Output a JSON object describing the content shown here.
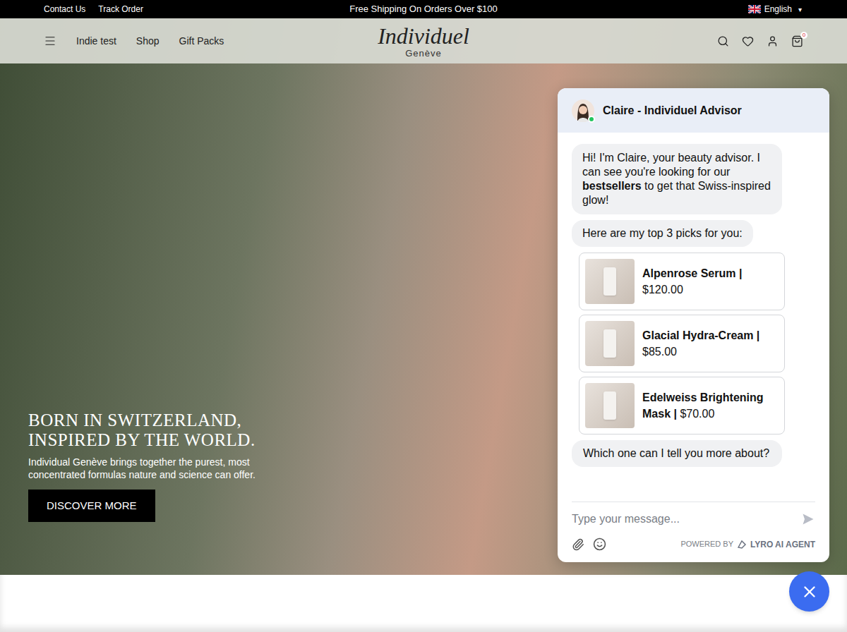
{
  "top_bar": {
    "links": [
      "Contact Us",
      "Track Order"
    ],
    "announcement": "Free Shipping On Orders Over $100",
    "language": "English",
    "language_caret": "▾"
  },
  "header": {
    "nav": [
      "Indie test",
      "Shop",
      "Gift Packs"
    ],
    "logo": {
      "name": "Individuel",
      "city": "Genève"
    },
    "cart_count": "0"
  },
  "hero": {
    "title_lines": [
      "BORN IN SWITZERLAND,",
      "INSPIRED BY THE WORLD."
    ],
    "text": "Individual Genève brings together the purest, most concentrated formulas nature and science can offer.",
    "button": "DISCOVER MORE"
  },
  "chat": {
    "agent": "Claire - Individuel Advisor",
    "online": true,
    "intro": [
      {
        "text": "Hi! I'm Claire, your beauty advisor. I can see you're looking for our ",
        "bold": false
      },
      {
        "text": "bestsellers",
        "bold": true
      },
      {
        "text": " to get that Swiss-inspired glow!",
        "bold": false
      }
    ],
    "picks_message": "Here are my top 3 picks for you:",
    "products": [
      {
        "name": "Alpenrose Serum |",
        "price": "$120.00"
      },
      {
        "name": "Glacial Hydra-Cream |",
        "price": "$85.00"
      },
      {
        "name": "Edelweiss Brightening Mask |",
        "price": "$70.00"
      }
    ],
    "question": "Which one can I tell you more about?",
    "input_placeholder": "Type your message...",
    "powered_by": "POWERED BY",
    "brand": "LYRO AI AGENT"
  }
}
